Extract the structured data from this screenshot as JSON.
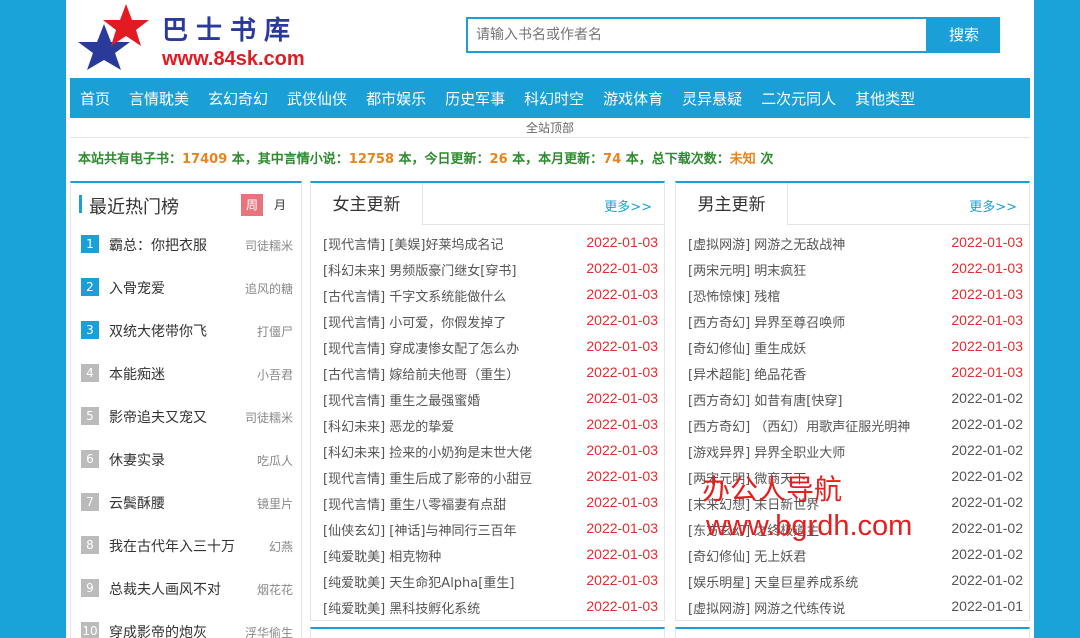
{
  "header": {
    "logo_title": "巴士书库",
    "logo_url": "www.84sk.com",
    "search_placeholder": "请输入书名或作者名",
    "search_button": "搜索"
  },
  "nav": [
    "首页",
    "言情耽美",
    "玄幻奇幻",
    "武侠仙侠",
    "都市娱乐",
    "历史军事",
    "科幻时空",
    "游戏体育",
    "灵异悬疑",
    "二次元同人",
    "其他类型"
  ],
  "subnav": "全站顶部",
  "stats": {
    "p1": "本站共有电子书：",
    "total": "17409",
    "p2": " 本，其中言情小说：",
    "romance": "12758",
    "p3": " 本，今日更新：",
    "today": "26",
    "p4": " 本，本月更新：",
    "month": "74",
    "p5": " 本，总下载次数：",
    "downloads": "未知",
    "p6": " 次"
  },
  "hot": {
    "title": "最近热门榜",
    "week": "周",
    "month": "月",
    "items": [
      {
        "rank": "1",
        "name": "霸总：你把衣服",
        "author": "司徒糯米"
      },
      {
        "rank": "2",
        "name": "入骨宠爱",
        "author": "追风的糖"
      },
      {
        "rank": "3",
        "name": "双统大佬带你飞",
        "author": "打僵尸"
      },
      {
        "rank": "4",
        "name": "本能痴迷",
        "author": "小吾君"
      },
      {
        "rank": "5",
        "name": "影帝追夫又宠又",
        "author": "司徒糯米"
      },
      {
        "rank": "6",
        "name": "休妻实录",
        "author": "吃瓜人"
      },
      {
        "rank": "7",
        "name": "云鬓酥腰",
        "author": "镜里片"
      },
      {
        "rank": "8",
        "name": "我在古代年入三十万",
        "author": "幻燕"
      },
      {
        "rank": "9",
        "name": "总裁夫人画风不对",
        "author": "烟花花"
      },
      {
        "rank": "10",
        "name": "穿成影帝的炮灰",
        "author": "浮华偷生"
      }
    ]
  },
  "female": {
    "title": "女主更新",
    "more": "更多>>",
    "rows": [
      {
        "cat": "[现代言情]",
        "name": "[美娱]好莱坞成名记",
        "date": "2022-01-03"
      },
      {
        "cat": "[科幻未来]",
        "name": "男频版豪门继女[穿书]",
        "date": "2022-01-03"
      },
      {
        "cat": "[古代言情]",
        "name": "千字文系统能做什么",
        "date": "2022-01-03"
      },
      {
        "cat": "[现代言情]",
        "name": "小可爱，你假发掉了",
        "date": "2022-01-03"
      },
      {
        "cat": "[现代言情]",
        "name": "穿成凄惨女配了怎么办",
        "date": "2022-01-03"
      },
      {
        "cat": "[古代言情]",
        "name": "嫁给前夫他哥（重生）",
        "date": "2022-01-03"
      },
      {
        "cat": "[现代言情]",
        "name": "重生之最强蜜婚",
        "date": "2022-01-03"
      },
      {
        "cat": "[科幻未来]",
        "name": "恶龙的挚爱",
        "date": "2022-01-03"
      },
      {
        "cat": "[科幻未来]",
        "name": "捡来的小奶狗是末世大佬",
        "date": "2022-01-03"
      },
      {
        "cat": "[现代言情]",
        "name": "重生后成了影帝的小甜豆",
        "date": "2022-01-03"
      },
      {
        "cat": "[现代言情]",
        "name": "重生八零福妻有点甜",
        "date": "2022-01-03"
      },
      {
        "cat": "[仙侠玄幻]",
        "name": "[神话]与神同行三百年",
        "date": "2022-01-03"
      },
      {
        "cat": "[纯爱耽美]",
        "name": "相克物种",
        "date": "2022-01-03"
      },
      {
        "cat": "[纯爱耽美]",
        "name": "天生命犯Alpha[重生]",
        "date": "2022-01-03"
      },
      {
        "cat": "[纯爱耽美]",
        "name": "黑科技孵化系统",
        "date": "2022-01-03"
      }
    ]
  },
  "male": {
    "title": "男主更新",
    "more": "更多>>",
    "rows": [
      {
        "cat": "[虚拟网游]",
        "name": "网游之无敌战神",
        "date": "2022-01-03"
      },
      {
        "cat": "[两宋元明]",
        "name": "明末疯狂",
        "date": "2022-01-03"
      },
      {
        "cat": "[恐怖惊悚]",
        "name": "残棺",
        "date": "2022-01-03"
      },
      {
        "cat": "[西方奇幻]",
        "name": "异界至尊召唤师",
        "date": "2022-01-03"
      },
      {
        "cat": "[奇幻修仙]",
        "name": "重生成妖",
        "date": "2022-01-03"
      },
      {
        "cat": "[异术超能]",
        "name": "绝品花香",
        "date": "2022-01-03"
      },
      {
        "cat": "[西方奇幻]",
        "name": "如昔有唐[快穿]",
        "date": "2022-01-02"
      },
      {
        "cat": "[西方奇幻]",
        "name": "（西幻）用歌声征服光明神",
        "date": "2022-01-02"
      },
      {
        "cat": "[游戏异界]",
        "name": "异界全职业大师",
        "date": "2022-01-02"
      },
      {
        "cat": "[两宋元明]",
        "name": "微商天下",
        "date": "2022-01-02"
      },
      {
        "cat": "[末来幻想]",
        "name": "末日新世界",
        "date": "2022-01-02"
      },
      {
        "cat": "[东方玄幻]",
        "name": "之终极道主",
        "date": "2022-01-02"
      },
      {
        "cat": "[奇幻修仙]",
        "name": "无上妖君",
        "date": "2022-01-02"
      },
      {
        "cat": "[娱乐明星]",
        "name": "天皇巨星养成系统",
        "date": "2022-01-02"
      },
      {
        "cat": "[虚拟网游]",
        "name": "网游之代练传说",
        "date": "2022-01-01"
      }
    ]
  },
  "watermark": {
    "line1": "办公人导航",
    "line2": "www.bgrdh.com"
  },
  "colors": {
    "accent": "#1a9fd6",
    "date_new": "#e32d2d",
    "rank_top": "#1a9fd6",
    "rank_other": "#bbbbbb",
    "week_tab": "#e8737d"
  }
}
